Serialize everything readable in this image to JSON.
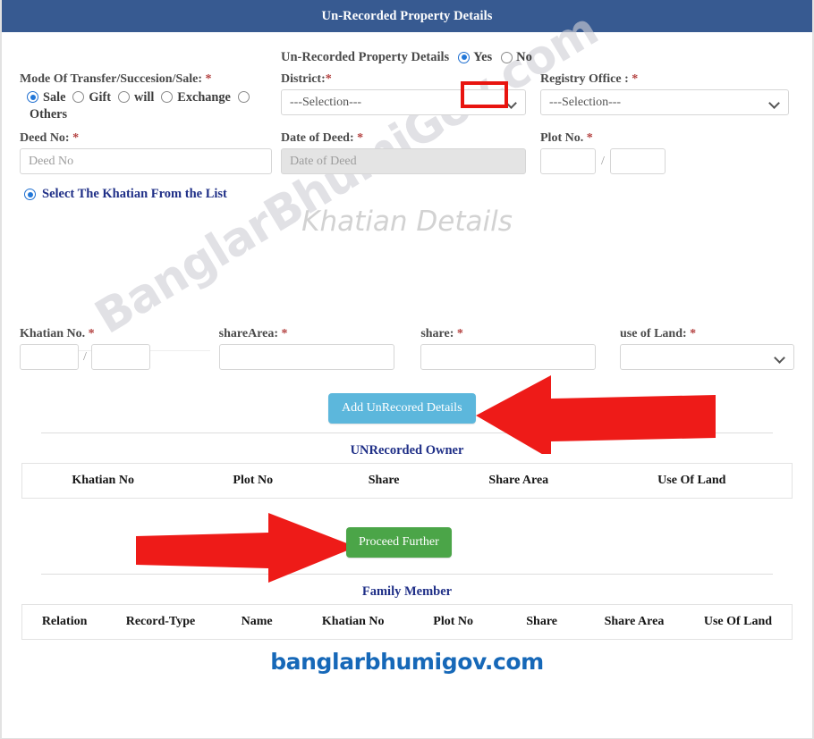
{
  "window": {
    "title": "Un-Recorded Property Details"
  },
  "toggle": {
    "label": "Un-Recorded Property Details",
    "yes": "Yes",
    "no": "No",
    "selected": "Yes",
    "highlight_color": "#e8140f"
  },
  "mode": {
    "label": "Mode Of Transfer/Succesion/Sale:",
    "required": "*",
    "options": [
      "Sale",
      "Gift",
      "will",
      "Exchange",
      "Others"
    ],
    "selected": "Sale"
  },
  "district": {
    "label": "District:",
    "required": "*",
    "value": "---Selection---"
  },
  "registry_office": {
    "label": "Registry Office :",
    "required": "*",
    "value": "---Selection---"
  },
  "deed_no": {
    "label": "Deed No:",
    "required": "*",
    "placeholder": "Deed No",
    "value": ""
  },
  "date_of_deed": {
    "label": "Date of Deed:",
    "required": "*",
    "placeholder": "Date of Deed",
    "value": ""
  },
  "plot_no": {
    "label": "Plot No.",
    "required": "*",
    "value_first": "",
    "value_second": "",
    "separator": "/"
  },
  "khatian_select": {
    "label": "Select The Khatian From the List",
    "selected": true
  },
  "khatian_watermark": "Khatian Details",
  "watermark": "BanglarBhumiGov.com",
  "khatian_no": {
    "label": "Khatian No.",
    "required": "*",
    "value_first": "",
    "value_second": "",
    "separator": "/"
  },
  "share_area": {
    "label": "shareArea:",
    "required": "*",
    "value": ""
  },
  "share": {
    "label": "share:",
    "required": "*",
    "value": ""
  },
  "use_of_land": {
    "label": "use of Land:",
    "required": "*",
    "value": ""
  },
  "buttons": {
    "add_unrecorded": "Add UnRecored Details",
    "add_unrecorded_color": "#5cb7dc",
    "proceed_further": "Proceed Further",
    "proceed_further_color": "#4ba548"
  },
  "unrecorded_owner_table": {
    "title": "UNRecorded Owner",
    "columns": [
      "Khatian No",
      "Plot No",
      "Share",
      "Share Area",
      "Use Of Land"
    ],
    "rows": []
  },
  "family_member_table": {
    "title": "Family Member",
    "columns": [
      "Relation",
      "Record-Type",
      "Name",
      "Khatian No",
      "Plot No",
      "Share",
      "Share Area",
      "Use Of Land"
    ],
    "rows": []
  },
  "footer": {
    "brand": "banglarbhumigov.com",
    "brand_color": "#1668b8"
  }
}
